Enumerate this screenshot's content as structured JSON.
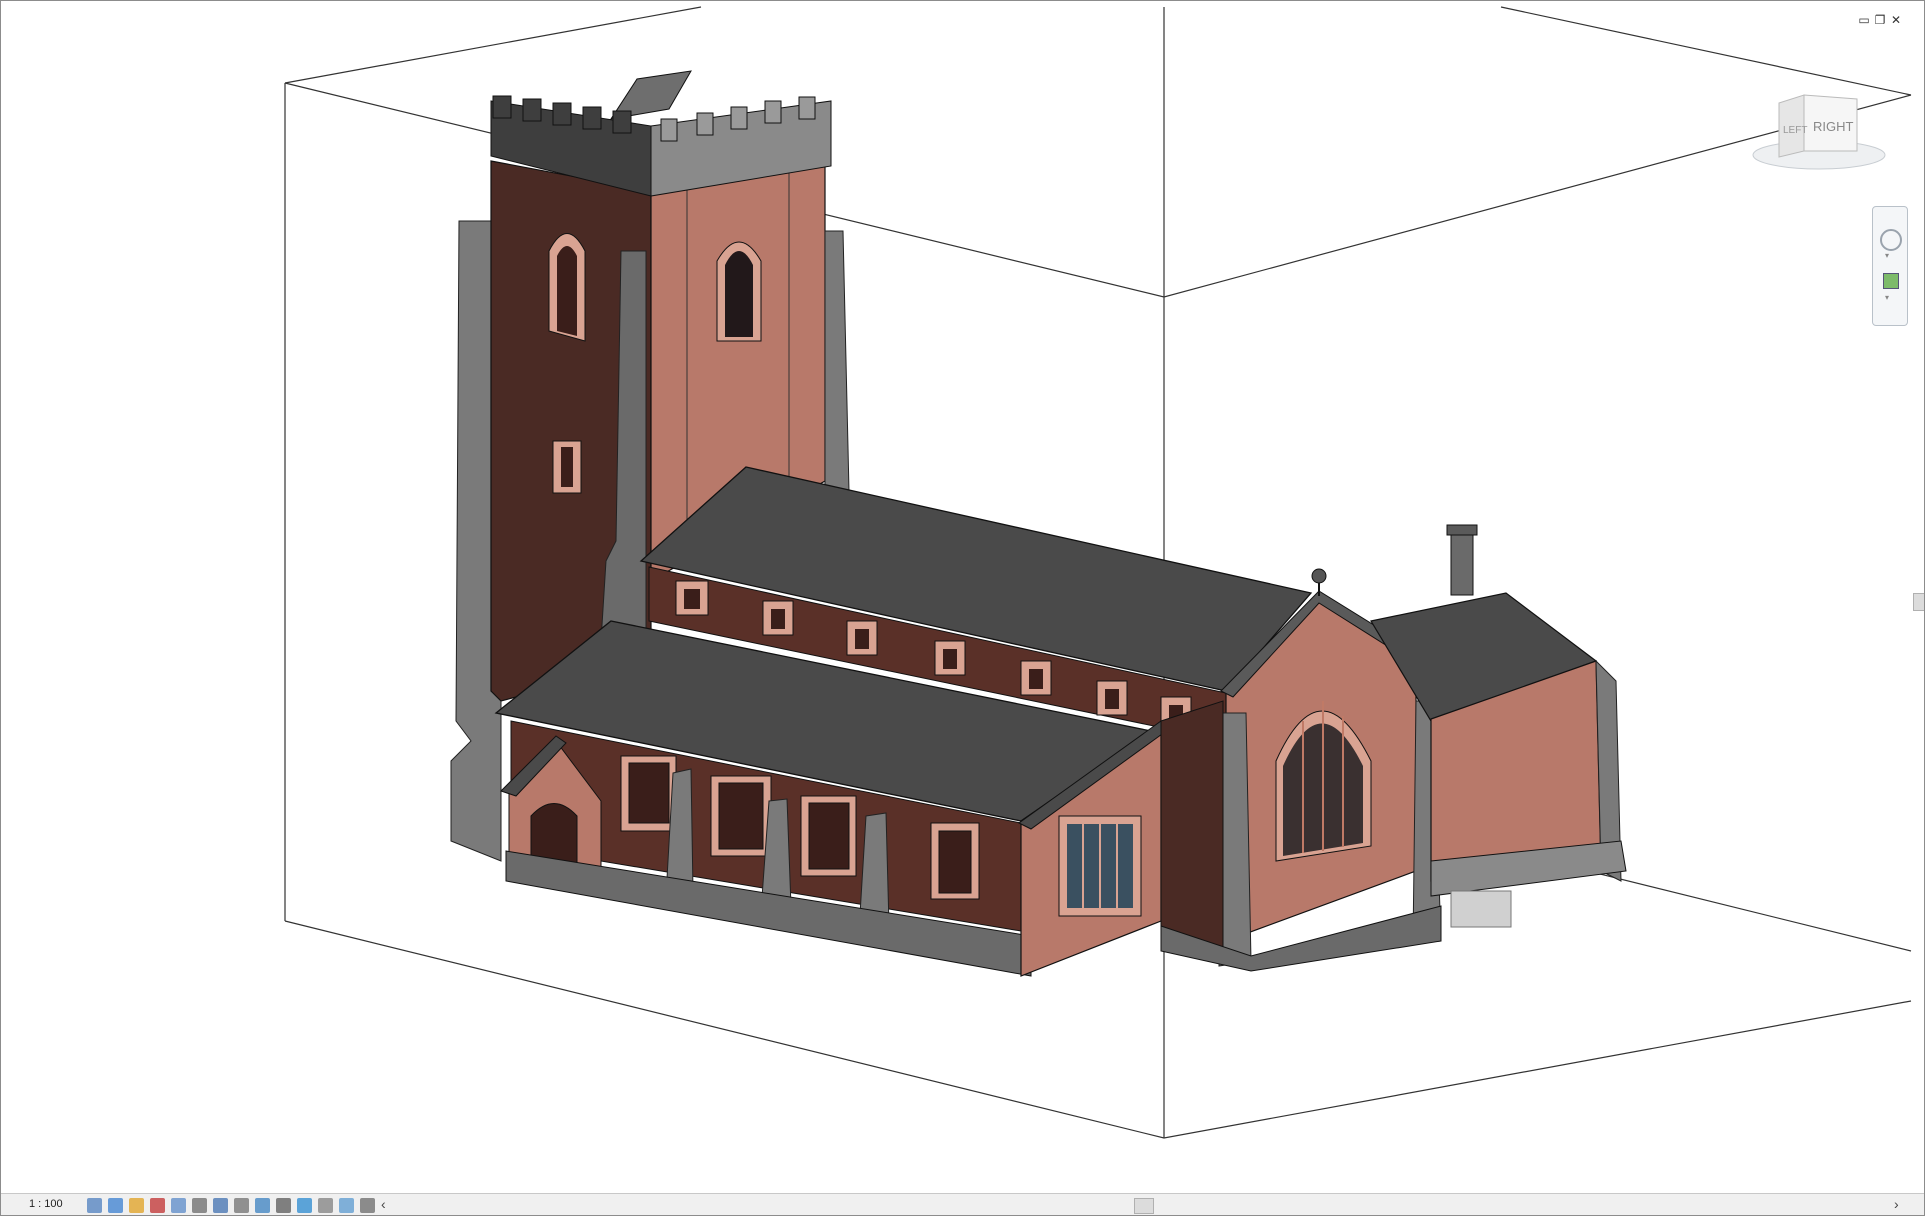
{
  "window": {
    "minimize_icon": "minimize-icon",
    "restore_icon": "restore-icon",
    "close_icon": "close-icon"
  },
  "viewcube": {
    "face_right": "RIGHT",
    "face_left": "LEFT"
  },
  "statusbar": {
    "scale": "1 : 100",
    "controls": [
      "detail-level-icon",
      "visual-style-icon",
      "sun-path-icon",
      "shadows-icon",
      "render-icon",
      "crop-view-icon",
      "show-crop-icon",
      "lock-3d-icon",
      "temporary-hide-icon",
      "reveal-hidden-icon",
      "analytical-model-icon",
      "highlight-displacement-icon",
      "worksharing-icon",
      "design-options-icon"
    ],
    "scroll_left": "‹",
    "scroll_right": "›"
  },
  "colors": {
    "brick_light": "#b8796a",
    "brick_dark": "#4a2a24",
    "roof": "#4a4a4a",
    "stone": "#8a8a8a",
    "stone_dark": "#606060"
  }
}
